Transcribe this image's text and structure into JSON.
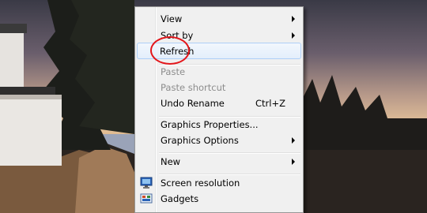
{
  "menu": {
    "items": [
      {
        "label": "View",
        "submenu": true
      },
      {
        "label": "Sort by",
        "submenu": true
      },
      {
        "label": "Refresh",
        "highlighted": true
      },
      {
        "label": "Paste",
        "disabled": true
      },
      {
        "label": "Paste shortcut",
        "disabled": true
      },
      {
        "label": "Undo Rename",
        "shortcut": "Ctrl+Z"
      },
      {
        "label": "Graphics Properties..."
      },
      {
        "label": "Graphics Options",
        "submenu": true
      },
      {
        "label": "New",
        "submenu": true
      },
      {
        "label": "Screen resolution",
        "icon": "screen-resolution-icon"
      },
      {
        "label": "Gadgets",
        "icon": "gadgets-icon"
      }
    ]
  },
  "annotation": {
    "color": "#e3161b",
    "target": "Refresh"
  }
}
